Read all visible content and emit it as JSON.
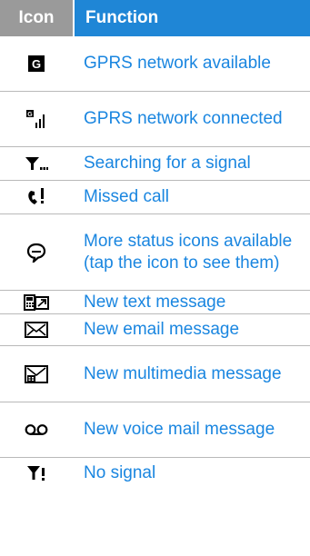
{
  "header": {
    "icon_col": "Icon",
    "function_col": "Function"
  },
  "rows": [
    {
      "icon": "gprs-available-icon",
      "text": "GPRS network available"
    },
    {
      "icon": "gprs-connected-icon",
      "text": "GPRS network connected"
    },
    {
      "icon": "signal-searching-icon",
      "text": "Searching for a signal"
    },
    {
      "icon": "missed-call-icon",
      "text": "Missed call"
    },
    {
      "icon": "more-status-icon",
      "text": "More status icons available (tap the icon to see them)"
    },
    {
      "icon": "text-message-icon",
      "text": "New text message"
    },
    {
      "icon": "email-message-icon",
      "text": "New email message"
    },
    {
      "icon": "multimedia-message-icon",
      "text": "New multimedia message"
    },
    {
      "icon": "voicemail-icon",
      "text": "New voice mail message"
    },
    {
      "icon": "no-signal-icon",
      "text": "No signal"
    }
  ],
  "colors": {
    "header_icon_bg": "#9a9a9a",
    "header_function_bg": "#1f86d6",
    "text": "#1a86e0"
  }
}
